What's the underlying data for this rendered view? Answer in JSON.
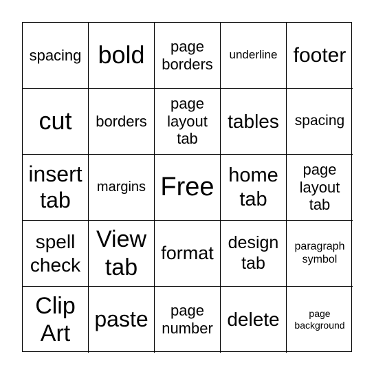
{
  "card": {
    "cells": [
      "spacing",
      "bold",
      "page borders",
      "underline",
      "footer",
      "cut",
      "borders",
      "page layout tab",
      "tables",
      "spacing",
      "insert tab",
      "margins",
      "Free",
      "home tab",
      "page layout tab",
      "spell check",
      "View tab",
      "format",
      "design tab",
      "paragraph symbol",
      "Clip Art",
      "paste",
      "page number",
      "delete",
      "page background"
    ],
    "free_cell_index": 12
  }
}
